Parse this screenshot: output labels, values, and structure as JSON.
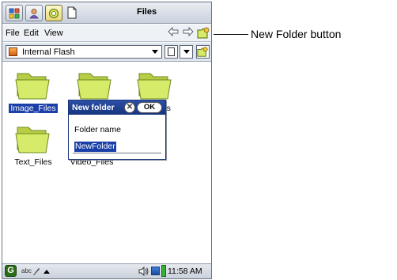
{
  "window": {
    "title": "Files",
    "taskbar_icons": [
      "apps-grid-icon",
      "contacts-icon",
      "files-app-icon",
      "document-icon"
    ]
  },
  "menubar": {
    "items": [
      "File",
      "Edit",
      "View"
    ],
    "back_icon": "back-arrow-icon",
    "forward_icon": "forward-arrow-icon",
    "new_folder_icon": "new-folder-icon"
  },
  "location": {
    "selected": "Internal Flash"
  },
  "files": [
    {
      "name": "Image_Files",
      "selected": true
    },
    {
      "name": "",
      "selected": false
    },
    {
      "name": "iles",
      "selected": false
    },
    {
      "name": "Text_Files",
      "selected": false
    },
    {
      "name": "Video_Files",
      "selected": false
    }
  ],
  "dialog": {
    "title": "New folder",
    "close_label": "✕",
    "ok_label": "OK",
    "field_label": "Folder name",
    "field_value": "NewFolder"
  },
  "statusbar": {
    "input_label": "abc",
    "time": "11:58 AM"
  },
  "callout": {
    "text": "New Folder button"
  },
  "colors": {
    "selection": "#1b3fa8",
    "dialog_title": "#16347f",
    "folder_fill": "#d6eb6a",
    "folder_edge": "#6b8a1e"
  }
}
